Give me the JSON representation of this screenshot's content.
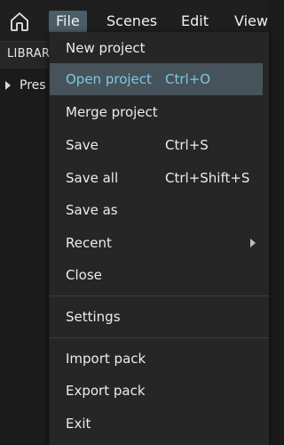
{
  "menubar": {
    "items": [
      {
        "label": "File"
      },
      {
        "label": "Scenes"
      },
      {
        "label": "Edit"
      },
      {
        "label": "View"
      }
    ]
  },
  "panel": {
    "title": "LIBRAR",
    "tree_item": "Pres"
  },
  "file_menu": {
    "items": [
      {
        "label": "New project",
        "shortcut": ""
      },
      {
        "label": "Open project",
        "shortcut": "Ctrl+O"
      },
      {
        "label": "Merge project",
        "shortcut": ""
      },
      {
        "label": "Save",
        "shortcut": "Ctrl+S"
      },
      {
        "label": "Save all",
        "shortcut": "Ctrl+Shift+S"
      },
      {
        "label": "Save as",
        "shortcut": ""
      },
      {
        "label": "Recent",
        "shortcut": ""
      },
      {
        "label": "Close",
        "shortcut": ""
      },
      {
        "label": "Settings",
        "shortcut": ""
      },
      {
        "label": "Import pack",
        "shortcut": ""
      },
      {
        "label": "Export pack",
        "shortcut": ""
      },
      {
        "label": "Exit",
        "shortcut": ""
      }
    ]
  }
}
